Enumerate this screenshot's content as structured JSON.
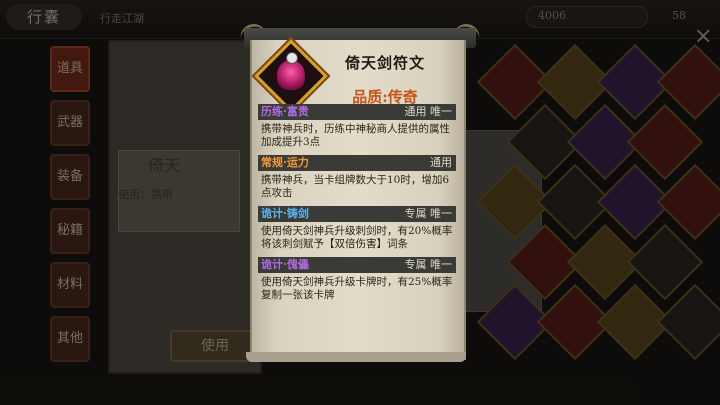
{
  "topbar": {
    "title": "行囊",
    "subtitle": "行走江湖",
    "coin_value": "4006",
    "level_value": "58",
    "close_label": "×"
  },
  "sidenav": {
    "items": [
      {
        "label": "道具"
      },
      {
        "label": "武器"
      },
      {
        "label": "装备"
      },
      {
        "label": "秘籍"
      },
      {
        "label": "材料"
      },
      {
        "label": "其他"
      }
    ]
  },
  "background": {
    "card_title": "倚天",
    "card_desc": "使用：携带",
    "use_button": "使用"
  },
  "popup": {
    "item_name": "倚天剑符文",
    "quality": "品质:传奇",
    "colors": {
      "quality": "#c4551b",
      "frame": "#d9a12b",
      "purple": "#b06ae0",
      "orange": "#f29a3a",
      "blue": "#5bb6f0"
    },
    "effects": [
      {
        "name": "历练·富贵",
        "tag": "通用 唯一",
        "color": "purple",
        "desc": "携带神兵时，历练中神秘商人提供的属性加成提升3点"
      },
      {
        "name": "常规·运力",
        "tag": "通用",
        "color": "orange",
        "desc": "携带神兵，当卡组牌数大于10时，增加6点攻击"
      },
      {
        "name": "诡计·铸剑",
        "tag": "专属 唯一",
        "color": "blue",
        "desc": "使用倚天剑神兵升级刺剑时，有20%概率将该刺剑赋予【双倍伤害】词条"
      },
      {
        "name": "诡计·傀儡",
        "tag": "专属 唯一",
        "color": "purple",
        "desc": "使用倚天剑神兵升级卡牌时，有25%概率复制一张该卡牌"
      }
    ]
  }
}
